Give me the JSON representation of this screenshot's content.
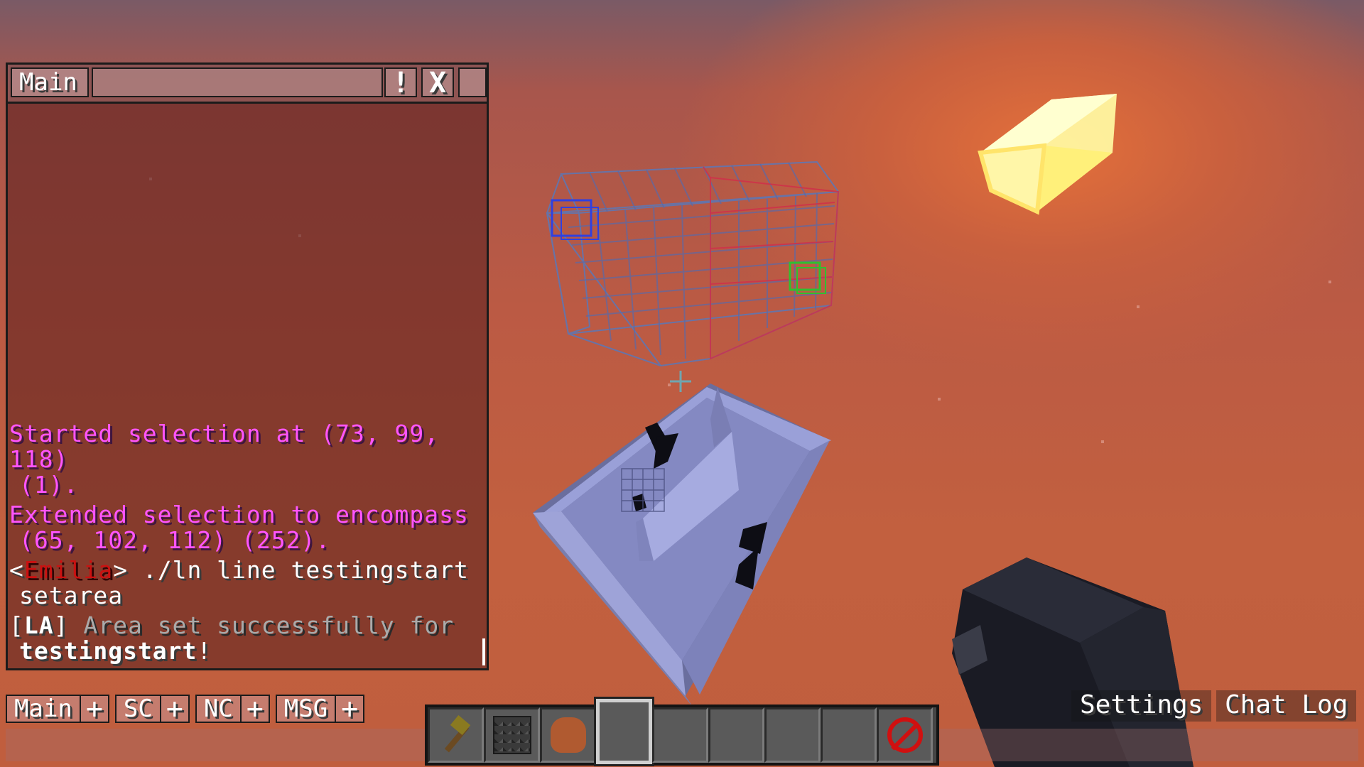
{
  "chat": {
    "window_tab": "Main",
    "alert_label": "!",
    "close_label": "X",
    "messages": [
      {
        "text": "Started selection at (73, 99, 118)",
        "cont": "(1)."
      },
      {
        "text": "Extended selection to encompass",
        "cont": "(65, 102, 112) (252)."
      },
      {
        "open": "<",
        "player": "Emilia",
        "close": ">",
        "text": " ./ln line testingstart",
        "cont": "setarea"
      },
      {
        "prefix_open": "[",
        "prefix": "LA",
        "prefix_close": "]",
        "text": " Area set successfully for",
        "cont_bold": "testingstart",
        "cont_end": "!"
      }
    ]
  },
  "channels": [
    {
      "label": "Main",
      "plus": "+"
    },
    {
      "label": "SC",
      "plus": "+"
    },
    {
      "label": "NC",
      "plus": "+"
    },
    {
      "label": "MSG",
      "plus": "+"
    }
  ],
  "buttons": {
    "settings": "Settings",
    "chat_log": "Chat Log"
  },
  "hotbar": {
    "selected_slot": 3,
    "slots": [
      "wooden-axe",
      "bedrock",
      "leather",
      "empty",
      "empty",
      "empty",
      "empty",
      "empty",
      "barrier"
    ]
  },
  "colors": {
    "system_message": "#ff55ff",
    "player_name": "#cc1010",
    "text": "#ffffff",
    "prefix": "#aaaaaa",
    "sky": "#c05e3e",
    "sun": "#fff7a0",
    "structure": "#8a8fc0"
  },
  "icons": {
    "crosshair": "crosshair-icon",
    "sun": "sun-block",
    "hand": "player-hand"
  }
}
